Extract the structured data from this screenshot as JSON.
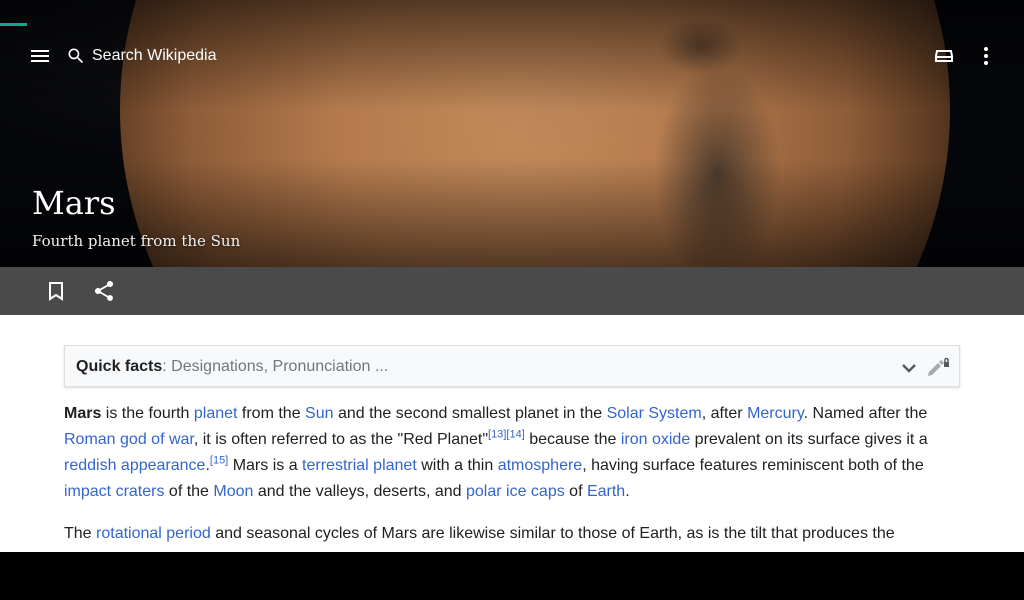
{
  "search": {
    "placeholder": "Search Wikipedia"
  },
  "icons": {
    "menu": "menu-icon",
    "search": "search-icon",
    "tabs": "tabs-icon",
    "more": "more-vert-icon",
    "save": "bookmark-icon",
    "share": "share-icon",
    "chevron": "chevron-down-icon",
    "edit": "edit-lock-icon"
  },
  "colors": {
    "link": "#3366cc",
    "progress": "#00af89",
    "actionbar": "#4a4a4a"
  },
  "article": {
    "title": "Mars",
    "description": "Fourth planet from the Sun",
    "quick_facts": {
      "label": "Quick facts",
      "separator": ": ",
      "rest": "Designations, Pronunciation ..."
    },
    "p1": {
      "t0": "Mars",
      "t1": " is the fourth ",
      "l1": "planet",
      "t2": " from the ",
      "l2": "Sun",
      "t3": " and the second smallest planet in the ",
      "l3": "Solar System",
      "t4": ", after ",
      "l4": "Mercury",
      "t5": ". Named after the ",
      "l5": "Roman god of war",
      "t6": ", it is often referred to as the \"Red Planet\"",
      "r1": "[13]",
      "r2": "[14]",
      "t7": " because the ",
      "l6": "iron oxide",
      "t8": " prevalent on its surface gives it a ",
      "l7": "reddish appearance",
      "t9": ".",
      "r3": "[15]",
      "t10": " Mars is a ",
      "l8": "terrestrial planet",
      "t11": " with a thin ",
      "l9": "atmosphere",
      "t12": ", having surface features reminiscent both of the ",
      "l10": "impact craters",
      "t13": " of the ",
      "l11": "Moon",
      "t14": " and the valleys, deserts, and ",
      "l12": "polar ice caps",
      "t15": " of ",
      "l13": "Earth",
      "t16": "."
    },
    "p2": {
      "t0": "The ",
      "l1": "rotational period",
      "t1": " and seasonal cycles of Mars are likewise similar to those of Earth, as is the tilt that produces the"
    }
  }
}
